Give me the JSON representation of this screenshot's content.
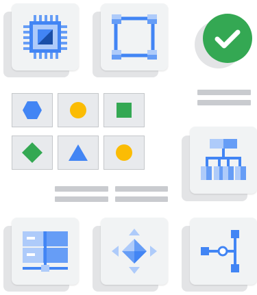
{
  "cards": [
    {
      "name": "chip-card",
      "icon": "processor-chip-icon"
    },
    {
      "name": "vector-card",
      "icon": "vector-square-icon"
    },
    {
      "name": "hierarchy-card",
      "icon": "hierarchy-tree-icon"
    },
    {
      "name": "storage-card",
      "icon": "server-stack-icon"
    },
    {
      "name": "move-card",
      "icon": "move-arrows-icon"
    },
    {
      "name": "connector-card",
      "icon": "pipeline-connector-icon"
    }
  ],
  "status": {
    "icon": "check-circle-icon",
    "color": "#34a853"
  },
  "shape_grid": [
    {
      "shape": "hexagon",
      "color": "#4285f4"
    },
    {
      "shape": "circle",
      "color": "#fbbc04"
    },
    {
      "shape": "square",
      "color": "#34a853"
    },
    {
      "shape": "diamond",
      "color": "#34a853"
    },
    {
      "shape": "triangle",
      "color": "#4285f4"
    },
    {
      "shape": "circle",
      "color": "#fbbc04"
    }
  ],
  "colors": {
    "blue": "#4285f4",
    "light_blue": "#aecbfa",
    "mid_blue": "#669df6",
    "green": "#34a853",
    "yellow": "#fbbc04",
    "card": "#f1f3f4",
    "shadow_card": "#e3e4e6",
    "bar": "#c9cbcf"
  }
}
